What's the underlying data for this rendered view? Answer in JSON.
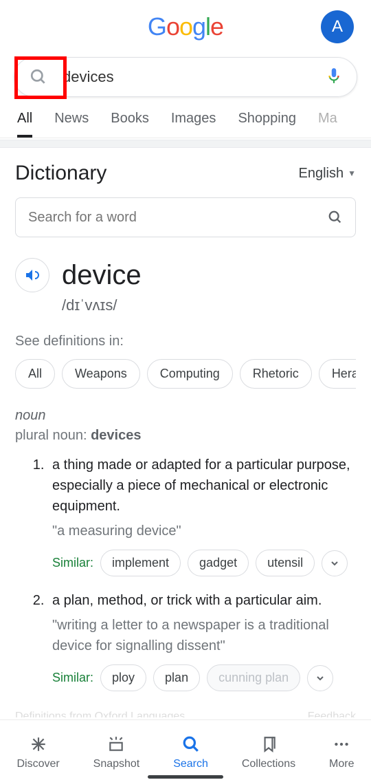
{
  "header": {
    "avatar_letter": "A"
  },
  "search": {
    "query": "devices"
  },
  "tabs": [
    "All",
    "News",
    "Books",
    "Images",
    "Shopping",
    "Ma"
  ],
  "active_tab": 0,
  "dictionary": {
    "title": "Dictionary",
    "language": "English",
    "search_placeholder": "Search for a word",
    "see_def_label": "See definitions in:",
    "word": "device",
    "pronunciation": "/dɪˈvʌɪs/",
    "categories": [
      "All",
      "Weapons",
      "Computing",
      "Rhetoric",
      "Heraldry"
    ],
    "pos": "noun",
    "plural_prefix": "plural noun: ",
    "plural_word": "devices",
    "defs": [
      {
        "text": "a thing made or adapted for a particular purpose, especially a piece of mechanical or electronic equipment.",
        "example": "\"a measuring device\"",
        "similar_label": "Similar:",
        "similar": [
          "implement",
          "gadget",
          "utensil"
        ],
        "faded_similar": []
      },
      {
        "text": "a plan, method, or trick with a particular aim.",
        "example": "\"writing a letter to a newspaper is a traditional device for signalling dissent\"",
        "similar_label": "Similar:",
        "similar": [
          "ploy",
          "plan"
        ],
        "faded_similar": [
          "cunning plan"
        ]
      }
    ],
    "source_label": "Definitions from Oxford Languages",
    "feedback_label": "Feedback"
  },
  "bottom_nav": {
    "items": [
      "Discover",
      "Snapshot",
      "Search",
      "Collections",
      "More"
    ],
    "active": 2
  }
}
